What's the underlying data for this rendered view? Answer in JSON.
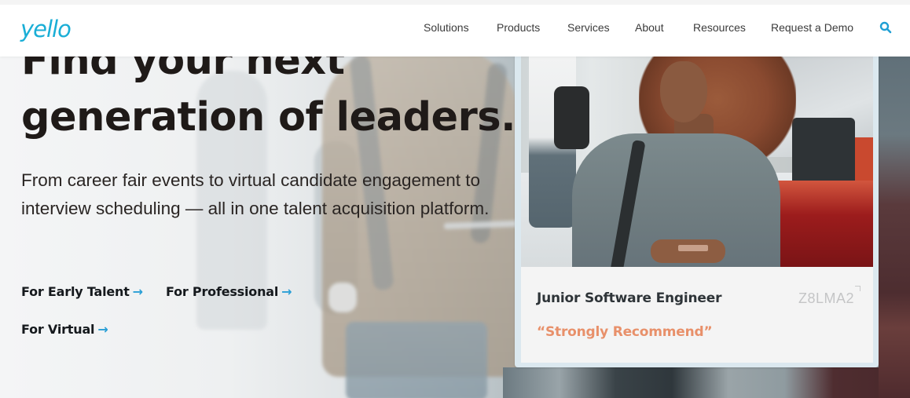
{
  "theme": {
    "brand": "#1aaed6",
    "accent": "#2a9fd6",
    "quote": "#e8906a",
    "headline_color": "#1f1a18"
  },
  "header": {
    "logo_text": "yello",
    "nav": [
      {
        "label": "Solutions"
      },
      {
        "label": "Products"
      },
      {
        "label": "Services"
      },
      {
        "label": "About"
      },
      {
        "label": "Resources"
      },
      {
        "label": "Request a Demo"
      }
    ],
    "search_icon": "search-icon"
  },
  "hero": {
    "headline_line1": "Find your next",
    "headline_line2": "generation of leaders.",
    "subhead": "From career fair events to virtual candidate engagement to interview scheduling — all in one talent acquisition platform.",
    "ctas": [
      {
        "label": "For Early Talent",
        "icon": "arrow-right-icon",
        "arrow": "→"
      },
      {
        "label": "For Professional",
        "icon": "arrow-right-icon",
        "arrow": "→"
      },
      {
        "label": "For Virtual",
        "icon": "arrow-right-icon",
        "arrow": "→"
      }
    ]
  },
  "candidate_card": {
    "title": "Junior Software Engineer",
    "code": "Z8LMA2",
    "quote": "“Strongly Recommend”",
    "photo_description": "Woman with curly hair in a grey sweater holding a phone"
  }
}
